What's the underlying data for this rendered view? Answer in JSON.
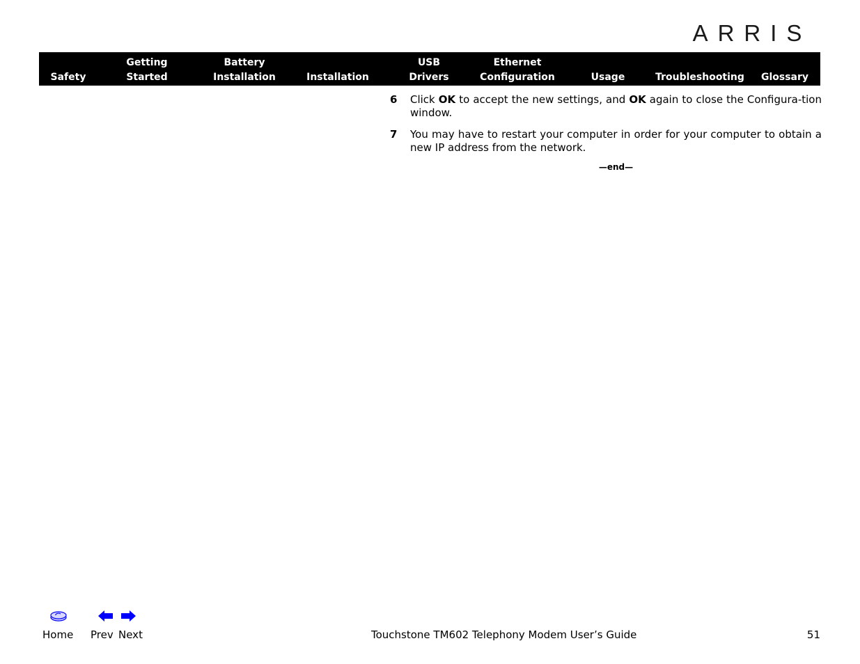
{
  "brand": {
    "logo_text": "ARRIS"
  },
  "nav": {
    "items": [
      {
        "line1": "",
        "line2": "Safety"
      },
      {
        "line1": "Getting",
        "line2": "Started"
      },
      {
        "line1": "Battery",
        "line2": "Installation"
      },
      {
        "line1": "",
        "line2": "Installation"
      },
      {
        "line1": "USB",
        "line2": "Drivers"
      },
      {
        "line1": "Ethernet",
        "line2": "Configuration"
      },
      {
        "line1": "",
        "line2": "Usage"
      },
      {
        "line1": "",
        "line2": "Troubleshooting"
      },
      {
        "line1": "",
        "line2": "Glossary"
      }
    ]
  },
  "content": {
    "steps": [
      {
        "number": "6",
        "parts": [
          "Click ",
          "OK",
          " to accept the new settings, and ",
          "OK",
          " again to close the Configura-tion window."
        ]
      },
      {
        "number": "7",
        "text": "You may have to restart your computer in order for your computer to obtain a new IP address from the network."
      }
    ],
    "end_marker": "—end—"
  },
  "footer": {
    "home_label": "Home",
    "prev_label": "Prev",
    "next_label": "Next",
    "title": "Touchstone TM602 Telephony Modem User’s Guide",
    "page_number": "51",
    "icons": {
      "home": "home-disc-icon",
      "prev": "left-arrow-icon",
      "next": "right-arrow-icon"
    },
    "icon_color": "#0000ff"
  }
}
